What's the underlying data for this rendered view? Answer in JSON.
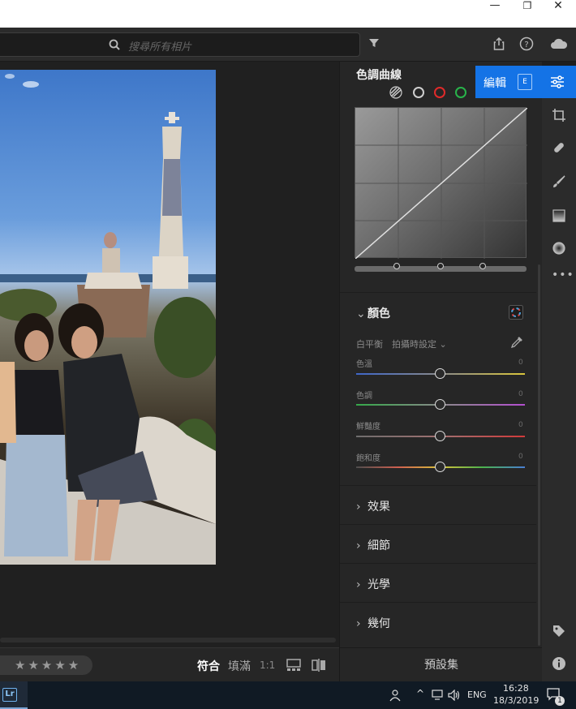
{
  "window": {
    "minimize": "—",
    "maximize": "❐",
    "close": "✕"
  },
  "topbar": {
    "search_placeholder": "搜尋所有相片",
    "icons": [
      "share-icon",
      "help-icon",
      "cloud-icon"
    ],
    "filter_icon": "filter-icon"
  },
  "edit_tab": {
    "label": "編輯",
    "shortcut": "E",
    "icon": "sliders-icon"
  },
  "panel": {
    "tone_curve": {
      "title": "色調曲線",
      "channel_icons": [
        "parametric-curve-icon",
        "rgb-channel-icon",
        "red-channel-icon",
        "green-channel-icon"
      ],
      "channel_colors": [
        "#cfcfcf",
        "#cfcfcf",
        "#e02a2a",
        "#28b34a"
      ]
    },
    "color": {
      "title": "顏色",
      "white_balance_label": "白平衡",
      "white_balance_value": "拍攝時設定",
      "sliders": [
        {
          "label": "色溫",
          "value": "0",
          "gradient": "linear-gradient(90deg,#3e66c8,#8a8a8a,#d9c53c)"
        },
        {
          "label": "色調",
          "value": "0",
          "gradient": "linear-gradient(90deg,#35a84a,#8a8a8a,#b44fd0)"
        },
        {
          "label": "鮮豔度",
          "value": "0",
          "gradient": "linear-gradient(90deg,#6e6e6e,#a07070,#d23a3a)"
        },
        {
          "label": "飽和度",
          "value": "0",
          "gradient": "linear-gradient(90deg,#4d4d4d,#d06050,#d7c13a,#4bb24d,#4a7fd4)"
        }
      ]
    },
    "sections": [
      "效果",
      "細節",
      "光學",
      "幾何"
    ],
    "presets_label": "預設集"
  },
  "bottombar": {
    "stars": "★★★★★",
    "fit": "符合",
    "fill": "填滿",
    "one_to_one": "1:1"
  },
  "rail_icons": [
    "crop-icon",
    "healing-icon",
    "brush-icon",
    "linear-gradient-icon",
    "radial-gradient-icon",
    "more-icon",
    "tag-icon",
    "info-icon"
  ],
  "taskbar": {
    "app_label": "Lr",
    "language": "ENG",
    "time": "16:28",
    "date": "18/3/2019",
    "notification_count": "1"
  }
}
